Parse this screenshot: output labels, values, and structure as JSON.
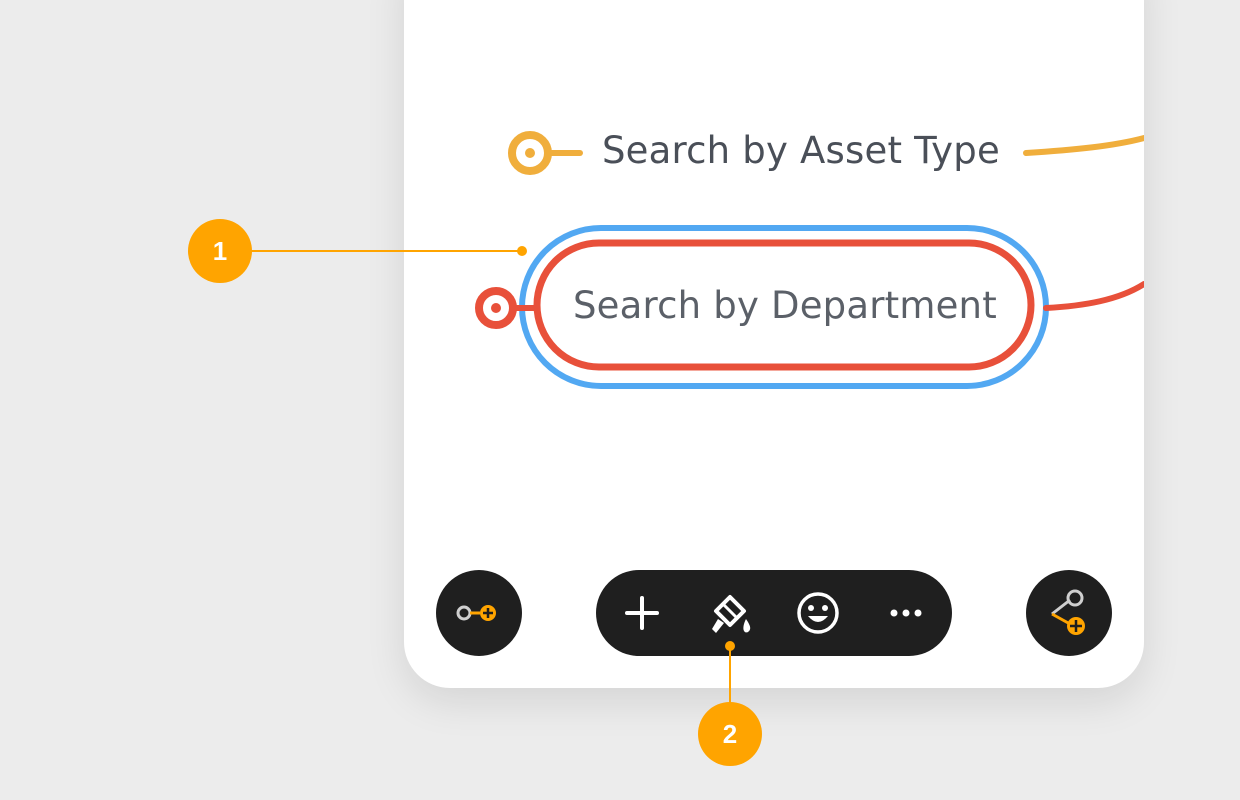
{
  "mindmap": {
    "topics": [
      {
        "label": "Search by Asset Type",
        "color": "#f0ae3c",
        "selected": false
      },
      {
        "label": "Search by Department",
        "color": "#e8503a",
        "selected": true
      }
    ],
    "selection_color": "#52a8f2"
  },
  "toolbar": {
    "left_button_icon": "add-subtopic-icon",
    "right_button_icon": "add-branch-icon",
    "items": [
      {
        "icon": "plus-icon",
        "name": "add"
      },
      {
        "icon": "paint-bucket-icon",
        "name": "style"
      },
      {
        "icon": "smiley-icon",
        "name": "sticker"
      },
      {
        "icon": "more-icon",
        "name": "more"
      }
    ],
    "background": "#1f1f1f",
    "accent": "#ffa400"
  },
  "callouts": [
    {
      "number": "1"
    },
    {
      "number": "2"
    }
  ]
}
